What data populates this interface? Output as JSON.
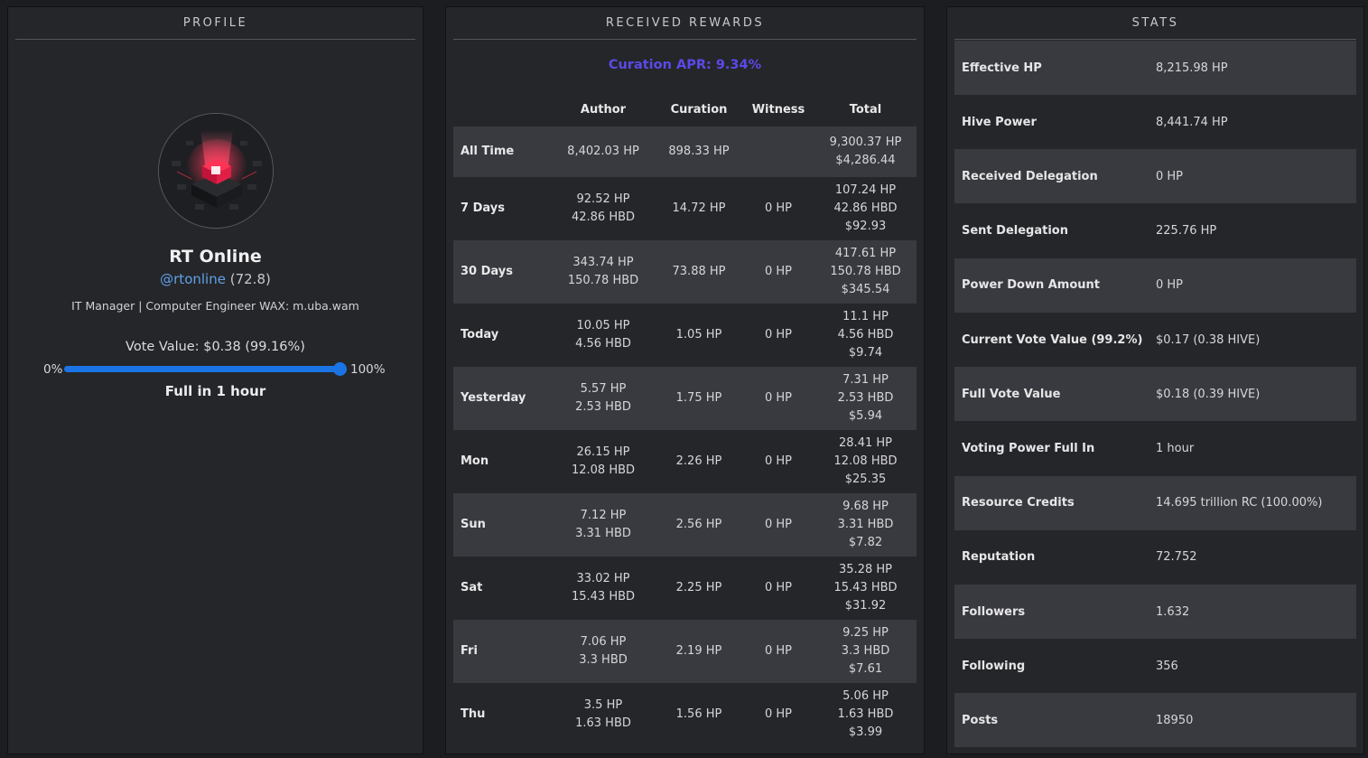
{
  "profile": {
    "title": "PROFILE",
    "name": "RT Online",
    "handle": "@rtonline",
    "reputation_display": "(72.8)",
    "bio": "IT Manager | Computer Engineer WAX: m.uba.wam",
    "vote_value": "Vote Value: $0.38 (99.16%)",
    "slider_min": "0%",
    "slider_max": "100%",
    "slider_level_pct": 99.16,
    "full_in": "Full in 1 hour",
    "accent_color": "#1b74e4",
    "link_color": "#5fa0e8"
  },
  "rewards": {
    "title": "RECEIVED REWARDS",
    "apr": "Curation APR: 9.34%",
    "apr_color": "#5b49e8",
    "headers": [
      "",
      "Author",
      "Curation",
      "Witness",
      "Total"
    ],
    "rows": [
      {
        "label": "All Time",
        "author": [
          "8,402.03 HP"
        ],
        "curation": "898.33 HP",
        "witness": "",
        "total": [
          "9,300.37 HP",
          "$4,286.44"
        ]
      },
      {
        "label": "7 Days",
        "author": [
          "92.52 HP",
          "42.86 HBD"
        ],
        "curation": "14.72 HP",
        "witness": "0 HP",
        "total": [
          "107.24 HP",
          "42.86 HBD",
          "$92.93"
        ]
      },
      {
        "label": "30 Days",
        "author": [
          "343.74 HP",
          "150.78 HBD"
        ],
        "curation": "73.88 HP",
        "witness": "0 HP",
        "total": [
          "417.61 HP",
          "150.78 HBD",
          "$345.54"
        ]
      },
      {
        "label": "Today",
        "author": [
          "10.05 HP",
          "4.56 HBD"
        ],
        "curation": "1.05 HP",
        "witness": "0 HP",
        "total": [
          "11.1 HP",
          "4.56 HBD",
          "$9.74"
        ]
      },
      {
        "label": "Yesterday",
        "author": [
          "5.57 HP",
          "2.53 HBD"
        ],
        "curation": "1.75 HP",
        "witness": "0 HP",
        "total": [
          "7.31 HP",
          "2.53 HBD",
          "$5.94"
        ]
      },
      {
        "label": "Mon",
        "author": [
          "26.15 HP",
          "12.08 HBD"
        ],
        "curation": "2.26 HP",
        "witness": "0 HP",
        "total": [
          "28.41 HP",
          "12.08 HBD",
          "$25.35"
        ]
      },
      {
        "label": "Sun",
        "author": [
          "7.12 HP",
          "3.31 HBD"
        ],
        "curation": "2.56 HP",
        "witness": "0 HP",
        "total": [
          "9.68 HP",
          "3.31 HBD",
          "$7.82"
        ]
      },
      {
        "label": "Sat",
        "author": [
          "33.02 HP",
          "15.43 HBD"
        ],
        "curation": "2.25 HP",
        "witness": "0 HP",
        "total": [
          "35.28 HP",
          "15.43 HBD",
          "$31.92"
        ]
      },
      {
        "label": "Fri",
        "author": [
          "7.06 HP",
          "3.3 HBD"
        ],
        "curation": "2.19 HP",
        "witness": "0 HP",
        "total": [
          "9.25 HP",
          "3.3 HBD",
          "$7.61"
        ]
      },
      {
        "label": "Thu",
        "author": [
          "3.5 HP",
          "1.63 HBD"
        ],
        "curation": "1.56 HP",
        "witness": "0 HP",
        "total": [
          "5.06 HP",
          "1.63 HBD",
          "$3.99"
        ]
      }
    ]
  },
  "stats": {
    "title": "STATS",
    "rows": [
      {
        "key": "Effective HP",
        "value": "8,215.98 HP"
      },
      {
        "key": "Hive Power",
        "value": "8,441.74 HP"
      },
      {
        "key": "Received Delegation",
        "value": "0 HP"
      },
      {
        "key": "Sent Delegation",
        "value": "225.76 HP"
      },
      {
        "key": "Power Down Amount",
        "value": "0 HP"
      },
      {
        "key": "Current Vote Value (99.2%)",
        "value": "$0.17 (0.38 HIVE)"
      },
      {
        "key": "Full Vote Value",
        "value": "$0.18 (0.39 HIVE)"
      },
      {
        "key": "Voting Power Full In",
        "value": "1 hour"
      },
      {
        "key": "Resource Credits",
        "value": "14.695 trillion RC (100.00%)"
      },
      {
        "key": "Reputation",
        "value": "72.752"
      },
      {
        "key": "Followers",
        "value": "1.632"
      },
      {
        "key": "Following",
        "value": "356"
      },
      {
        "key": "Posts",
        "value": "18950"
      }
    ]
  }
}
